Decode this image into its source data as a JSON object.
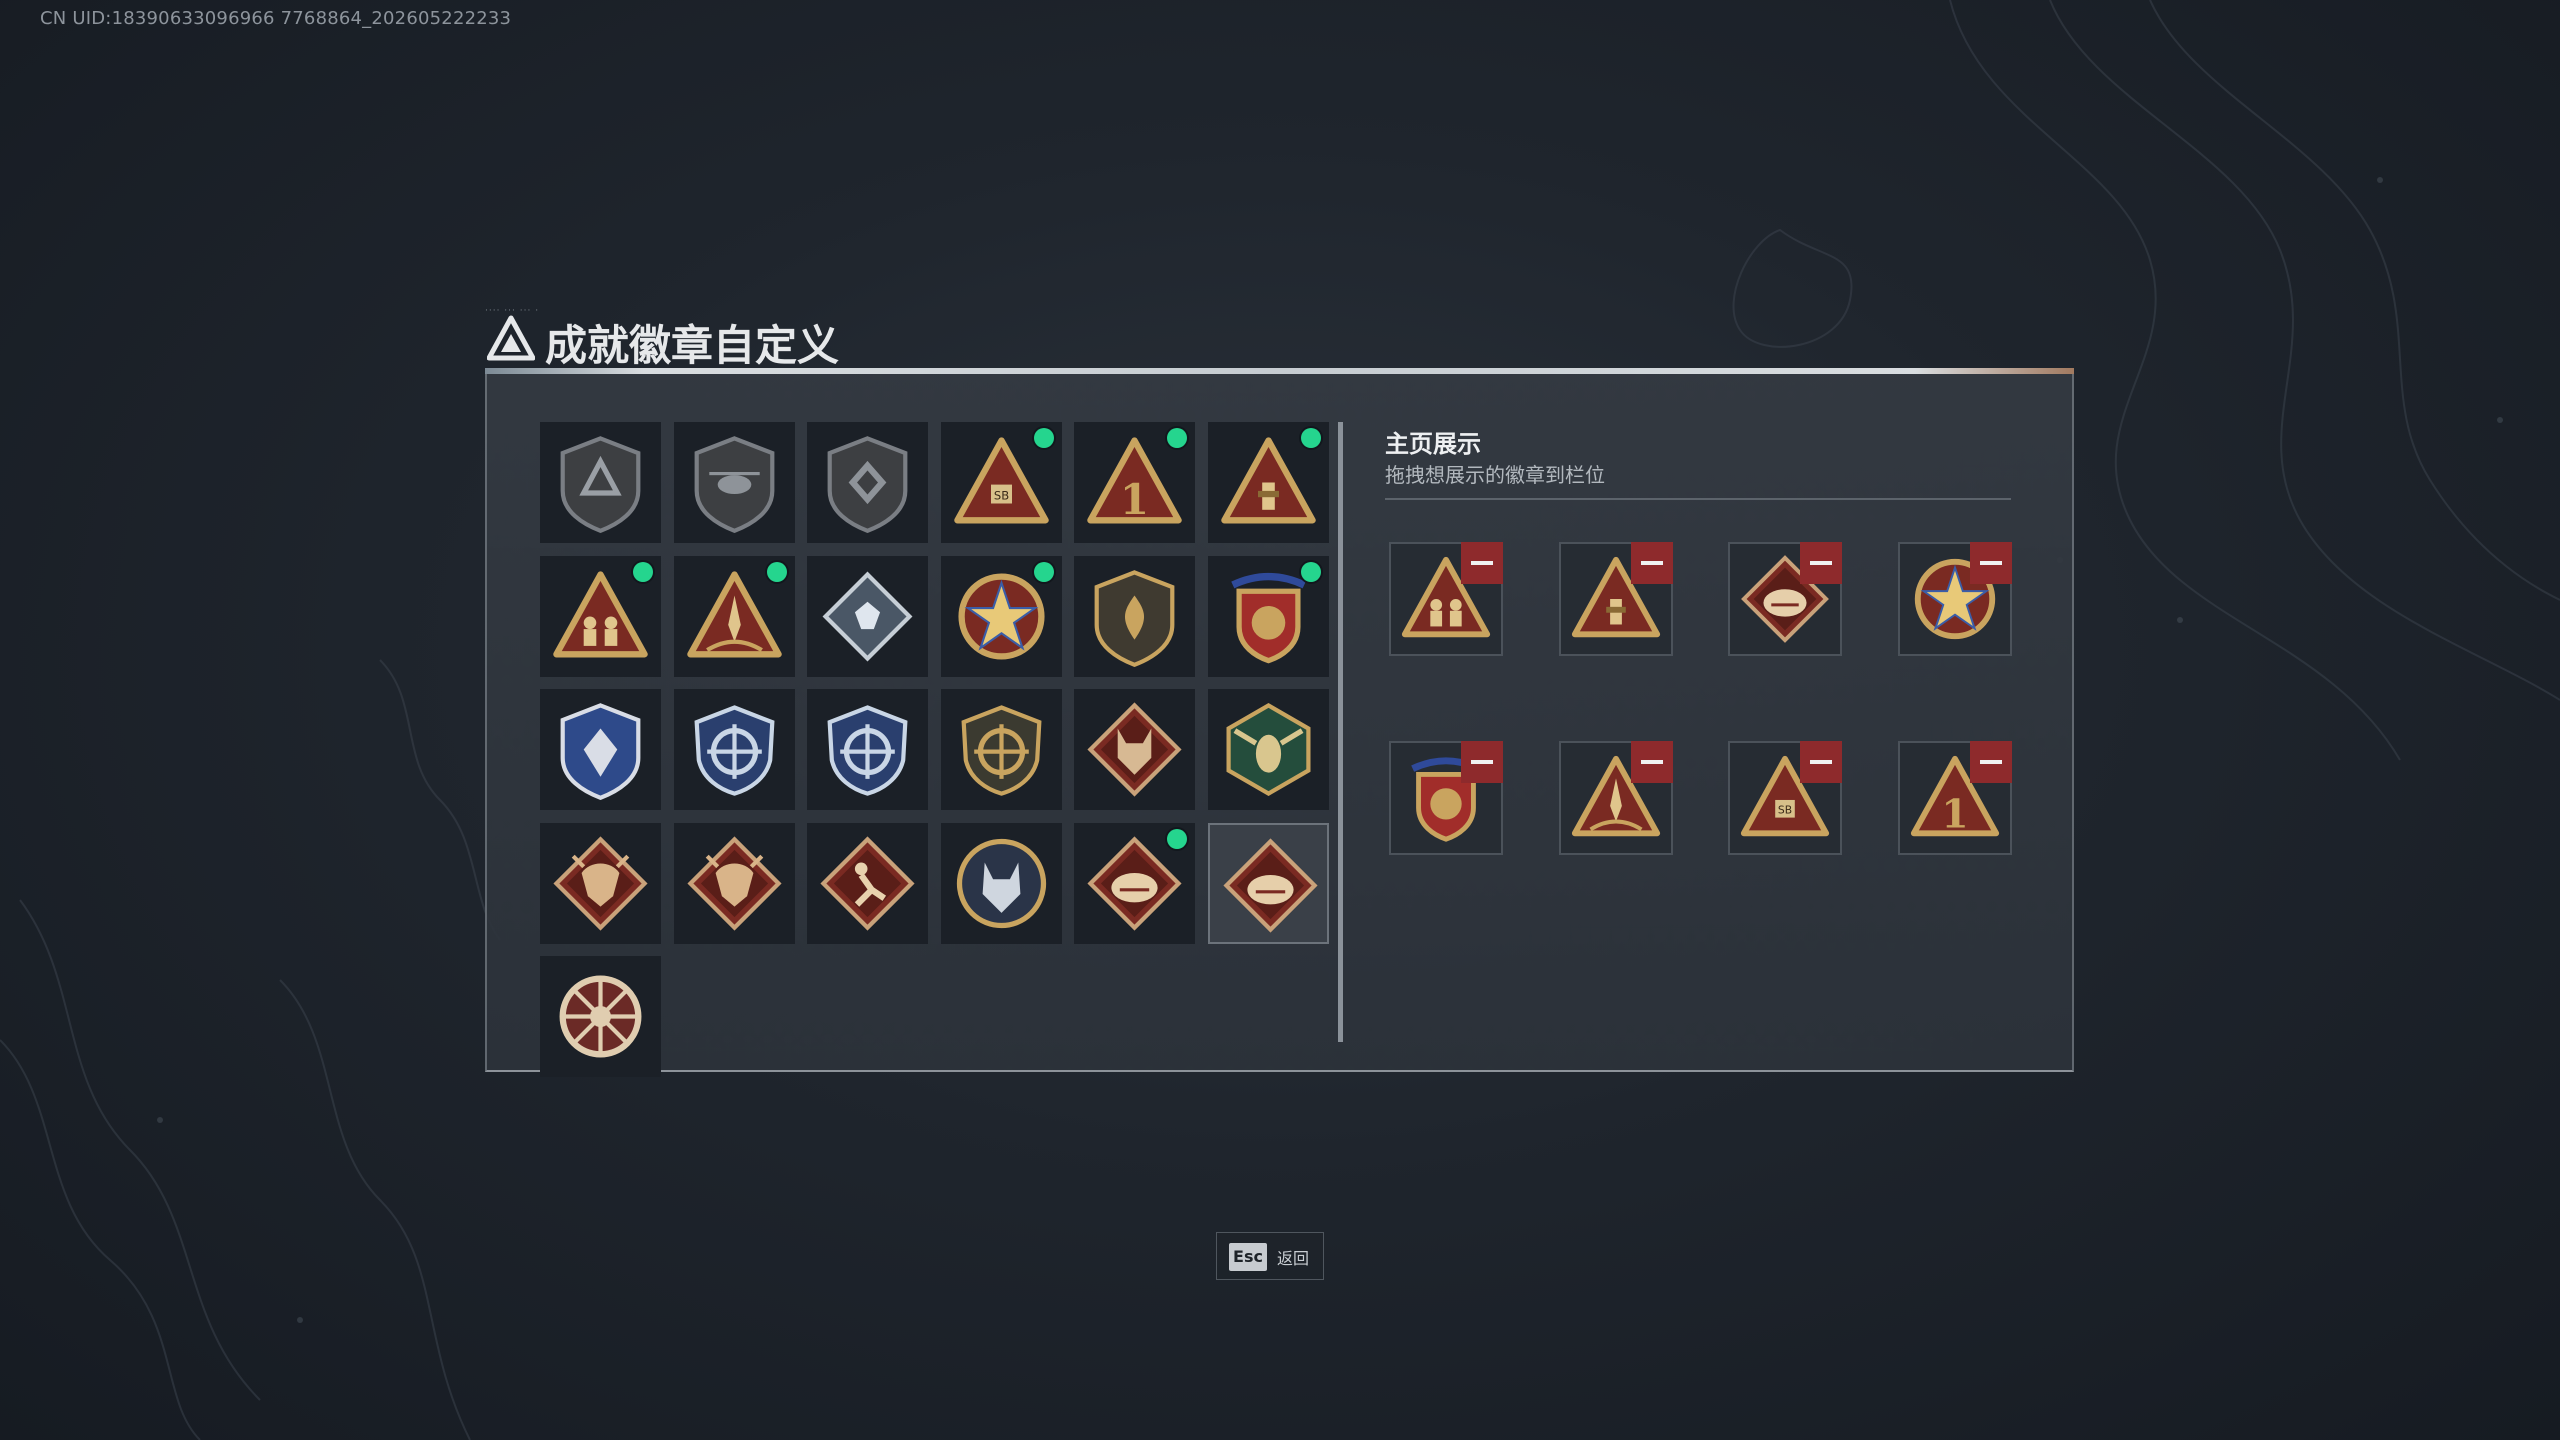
{
  "uid_text": "CN UID:18390633096966 7768864_202605222233",
  "header": {
    "title": "成就徽章自定义",
    "tiny_text": "···· ··· ··· ·"
  },
  "left_grid": {
    "badges": [
      {
        "icon": "delta-shield-badge-icon",
        "new": false,
        "selected": false
      },
      {
        "icon": "helicopter-shield-badge-icon",
        "new": false,
        "selected": false
      },
      {
        "icon": "diamond-shield-badge-icon",
        "new": false,
        "selected": false
      },
      {
        "icon": "sb-triangle-badge-icon",
        "new": true,
        "selected": false
      },
      {
        "icon": "number-one-triangle-badge-icon",
        "new": true,
        "selected": false
      },
      {
        "icon": "tower-triangle-badge-icon",
        "new": true,
        "selected": false
      },
      {
        "icon": "soldiers-triangle-badge-icon",
        "new": true,
        "selected": false
      },
      {
        "icon": "rocket-triangle-badge-icon",
        "new": true,
        "selected": false
      },
      {
        "icon": "crystal-diamond-badge-icon",
        "new": false,
        "selected": false
      },
      {
        "icon": "star-medal-badge-icon",
        "new": true,
        "selected": false
      },
      {
        "icon": "fire-shield-badge-icon",
        "new": false,
        "selected": false
      },
      {
        "icon": "eagle-crest-badge-icon",
        "new": true,
        "selected": false
      },
      {
        "icon": "blue-dragon-shield-badge-icon",
        "new": false,
        "selected": false
      },
      {
        "icon": "blue-crosshair-badge-icon",
        "new": false,
        "selected": false
      },
      {
        "icon": "blue-crosshair-badge-icon-2",
        "new": false,
        "selected": false
      },
      {
        "icon": "gold-crosshair-badge-icon",
        "new": false,
        "selected": false
      },
      {
        "icon": "wolf-diamond-badge-icon",
        "new": false,
        "selected": false
      },
      {
        "icon": "green-hornet-badge-icon",
        "new": false,
        "selected": false
      },
      {
        "icon": "dragon-diamond-badge-icon",
        "new": false,
        "selected": false
      },
      {
        "icon": "dragon-diamond-badge-icon-2",
        "new": false,
        "selected": false
      },
      {
        "icon": "runner-diamond-badge-icon",
        "new": false,
        "selected": false
      },
      {
        "icon": "wolf-circle-badge-icon",
        "new": false,
        "selected": false
      },
      {
        "icon": "raptor-diamond-badge-icon",
        "new": true,
        "selected": false
      },
      {
        "icon": "raptor-diamond-badge-icon-2",
        "new": false,
        "selected": true
      },
      {
        "icon": "wheel-badge-icon",
        "new": false,
        "selected": false
      }
    ]
  },
  "right_panel": {
    "title": "主页展示",
    "subtitle": "拖拽想展示的徽章到栏位",
    "slots": [
      {
        "icon": "soldiers-triangle-badge-icon"
      },
      {
        "icon": "tower-triangle-badge-icon"
      },
      {
        "icon": "raptor-diamond-badge-icon"
      },
      {
        "icon": "star-medal-badge-icon"
      },
      {
        "icon": "eagle-crest-badge-icon"
      },
      {
        "icon": "rocket-triangle-badge-icon"
      },
      {
        "icon": "sb-triangle-badge-icon"
      },
      {
        "icon": "number-one-triangle-badge-icon"
      }
    ]
  },
  "esc": {
    "key": "Esc",
    "label": "返回"
  },
  "colors": {
    "new_dot": "#25d58e",
    "remove_button": "#8e2a2c",
    "gold": "#c9a45f",
    "maroon": "#7a2a22"
  }
}
